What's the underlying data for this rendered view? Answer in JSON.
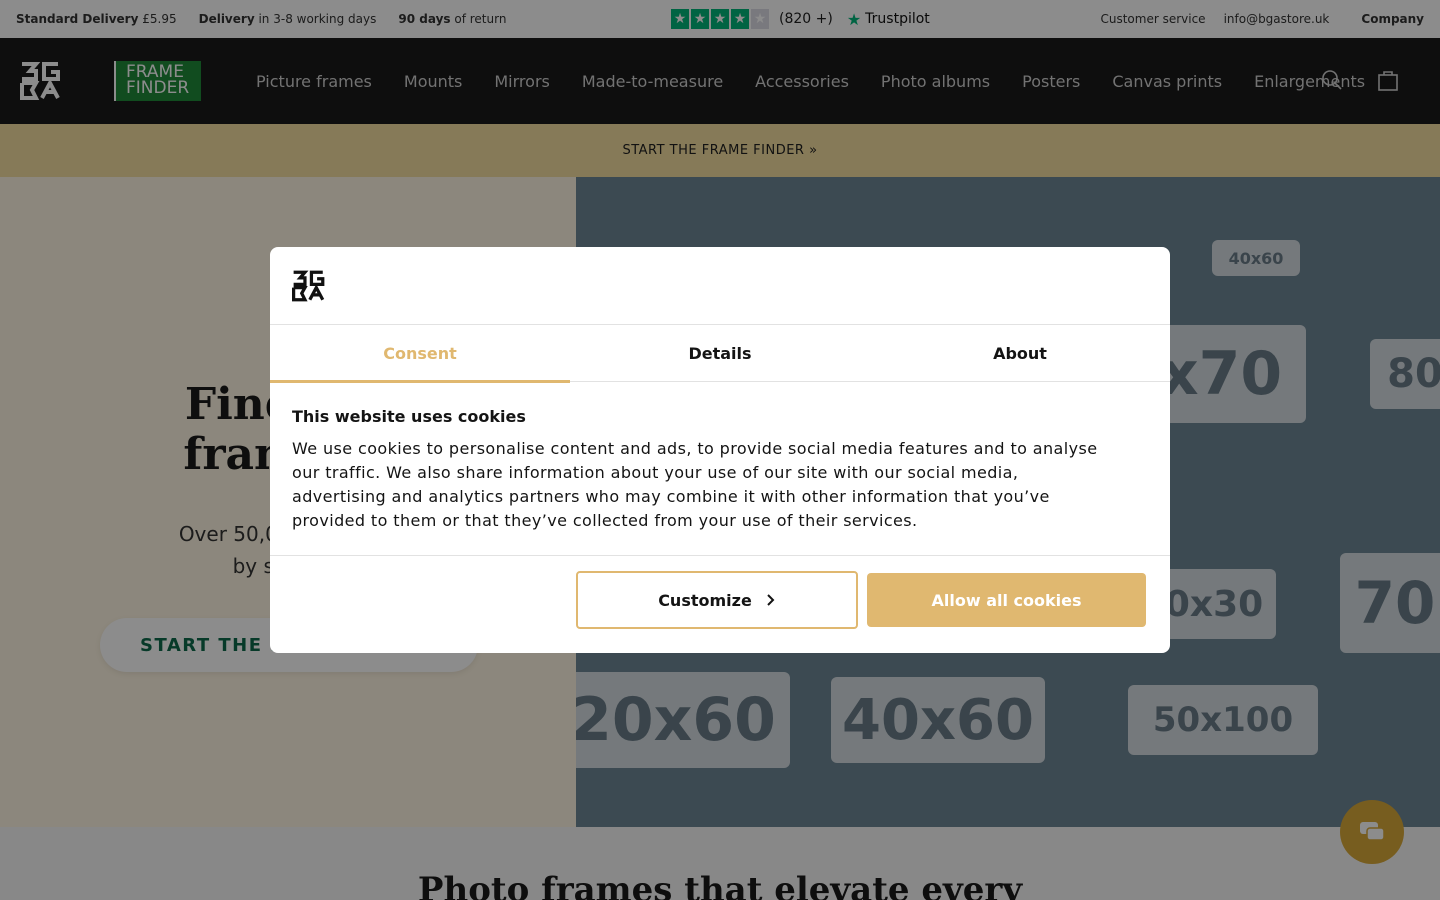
{
  "topbar": {
    "delivery_label": "Standard Delivery",
    "delivery_price": "£5.95",
    "delivery_time_label": "Delivery",
    "delivery_time": "in 3-8 working days",
    "returns_days": "90 days",
    "returns_text": "of return",
    "rating_count": "(820 +)",
    "trustpilot": "Trustpilot",
    "stars_filled": 4,
    "stars_total": 5,
    "customer_service": "Customer service",
    "email": "info@bgastore.uk",
    "company": "Company"
  },
  "nav": {
    "logo_text": "BGA",
    "badge_line1": "FRAME",
    "badge_line2": "FINDER",
    "items": [
      "Picture frames",
      "Mounts",
      "Mirrors",
      "Made-to-measure",
      "Accessories",
      "Photo albums",
      "Posters",
      "Canvas prints",
      "Enlargements"
    ],
    "search_icon": "search-icon",
    "cart_icon": "cart-icon"
  },
  "promo": {
    "text": "START THE FRAME FINDER »"
  },
  "hero": {
    "title_line1": "Find the",
    "title_line2": "frame in",
    "subtitle_line1": "Over 50,000 photo fra",
    "subtitle_line2": "by step to t",
    "cta": "START THE F",
    "tiles": [
      "40x60",
      "x70",
      "80",
      "0x30",
      "70",
      "20x60",
      "40x60",
      "50x100"
    ]
  },
  "below_heading": "Photo frames that elevate every",
  "cookie_dialog": {
    "logo_text": "BGA",
    "tabs": [
      "Consent",
      "Details",
      "About"
    ],
    "active_tab": "Consent",
    "title": "This website uses cookies",
    "body": "We use cookies to personalise content and ads, to provide social media features and to analyse our traffic. We also share information about your use of our site with our social media, advertising and analytics partners who may combine it with other information that you’ve provided to them or that they’ve collected from your use of their services.",
    "customize_label": "Customize",
    "allow_all_label": "Allow all cookies"
  },
  "colors": {
    "accent": "#e0b870",
    "nav_bg": "#1a1a1a",
    "promo_bg": "#f5dfa0",
    "trustpilot_green": "#00b67a",
    "chat_bg": "#d9a93a"
  },
  "chat": {
    "icon": "chat-icon"
  }
}
